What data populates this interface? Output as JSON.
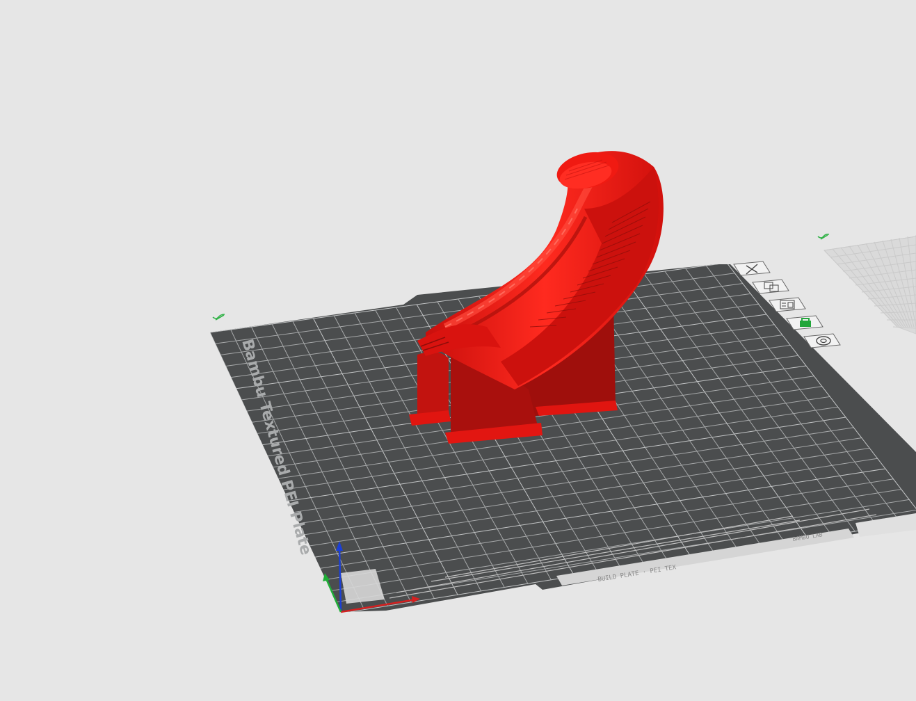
{
  "plate": {
    "name": "Bambu Textured PEI Plate",
    "footer_text": "BUILD PLATE · PEI TEX",
    "right_footer_text": "BAMBU LAB"
  },
  "colors": {
    "background": "#e6e6e6",
    "plate": "#4b4d4e",
    "grid": "#a7a9aa",
    "model": "#e8120e",
    "model_shade": "#a3100d",
    "axis_x": "#d62020",
    "axis_y": "#1fae37",
    "axis_z": "#1b3fd6",
    "plate_marker": "#34b34a"
  },
  "plate_toolbar": [
    {
      "id": "close",
      "icon": "close-icon"
    },
    {
      "id": "arrange",
      "icon": "arrange-icon"
    },
    {
      "id": "orient",
      "icon": "orient-icon"
    },
    {
      "id": "lock",
      "icon": "lock-icon"
    },
    {
      "id": "settings",
      "icon": "settings-icon"
    }
  ],
  "models": [
    {
      "name": "curved-stand-model",
      "color": "#e8120e"
    }
  ]
}
